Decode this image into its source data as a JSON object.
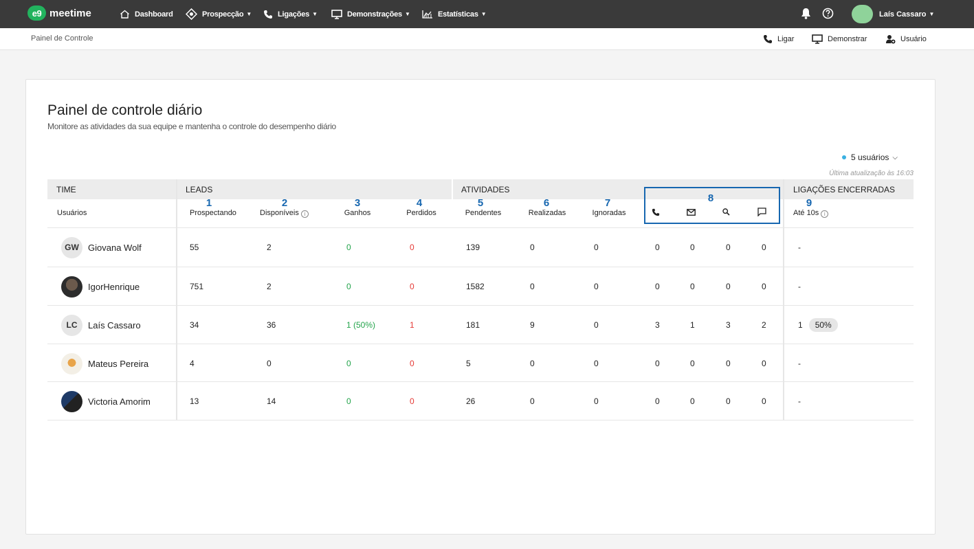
{
  "brand": {
    "mark": "e9",
    "name": "meetime"
  },
  "nav": {
    "dashboard": "Dashboard",
    "prospeccao": "Prospecção",
    "ligacoes": "Ligações",
    "demonstracoes": "Demonstrações",
    "estatisticas": "Estatísticas",
    "user": "Laís Cassaro"
  },
  "subbar": {
    "breadcrumb": "Painel de Controle",
    "ligar": "Ligar",
    "demonstrar": "Demonstrar",
    "usuario": "Usuário"
  },
  "page": {
    "title": "Painel de controle diário",
    "subtitle": "Monitore as atividades da sua equipe e mantenha o controle do desempenho diário",
    "users_filter": "5 usuários",
    "last_update": "Última atualização às 16:03"
  },
  "table": {
    "groups": {
      "time": "TIME",
      "leads": "LEADS",
      "atividades": "ATIVIDADES",
      "ligacoes": "LIGAÇÕES ENCERRADAS"
    },
    "headers": {
      "usuarios": "Usuários",
      "prospectando": "Prospectando",
      "disponiveis": "Disponíveis",
      "ganhos": "Ganhos",
      "perdidos": "Perdidos",
      "pendentes": "Pendentes",
      "realizadas": "Realizadas",
      "ignoradas": "Ignoradas",
      "ate10s": "Até 10s"
    },
    "markers": [
      "1",
      "2",
      "3",
      "4",
      "5",
      "6",
      "7",
      "8",
      "9"
    ],
    "rows": [
      {
        "initials": "GW",
        "name": "Giovana Wolf",
        "prospectando": "55",
        "disponiveis": "2",
        "ganhos": "0",
        "perdidos": "0",
        "pendentes": "139",
        "realizadas": "0",
        "ignoradas": "0",
        "call": "0",
        "email": "0",
        "search": "0",
        "chat": "0",
        "ate10s": "-",
        "pct": ""
      },
      {
        "initials": "",
        "name": "IgorHenrique",
        "prospectando": "751",
        "disponiveis": "2",
        "ganhos": "0",
        "perdidos": "0",
        "pendentes": "1582",
        "realizadas": "0",
        "ignoradas": "0",
        "call": "0",
        "email": "0",
        "search": "0",
        "chat": "0",
        "ate10s": "-",
        "pct": ""
      },
      {
        "initials": "LC",
        "name": "Laís Cassaro",
        "prospectando": "34",
        "disponiveis": "36",
        "ganhos": "1 (50%)",
        "perdidos": "1",
        "pendentes": "181",
        "realizadas": "9",
        "ignoradas": "0",
        "call": "3",
        "email": "1",
        "search": "3",
        "chat": "2",
        "ate10s": "1",
        "pct": "50%"
      },
      {
        "initials": "",
        "name": "Mateus Pereira",
        "prospectando": "4",
        "disponiveis": "0",
        "ganhos": "0",
        "perdidos": "0",
        "pendentes": "5",
        "realizadas": "0",
        "ignoradas": "0",
        "call": "0",
        "email": "0",
        "search": "0",
        "chat": "0",
        "ate10s": "-",
        "pct": ""
      },
      {
        "initials": "",
        "name": "Victoria Amorim",
        "prospectando": "13",
        "disponiveis": "14",
        "ganhos": "0",
        "perdidos": "0",
        "pendentes": "26",
        "realizadas": "0",
        "ignoradas": "0",
        "call": "0",
        "email": "0",
        "search": "0",
        "chat": "0",
        "ate10s": "-",
        "pct": ""
      }
    ]
  },
  "colors": {
    "topbar": "#3a3a3a",
    "brand_green": "#22b35e",
    "marker_blue": "#1767b0",
    "positive": "#22a34a",
    "negative": "#e53935"
  }
}
